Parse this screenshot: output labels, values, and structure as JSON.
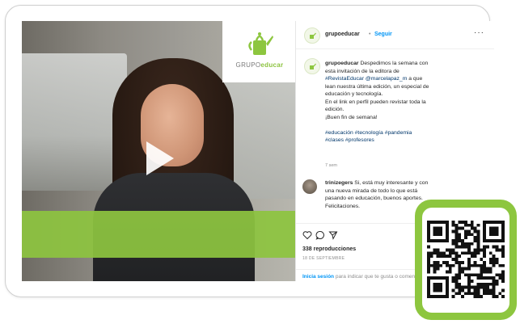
{
  "colors": {
    "brand_green": "#8dc63f",
    "link_blue": "#0095f6",
    "hashtag_blue": "#00376b",
    "muted_gray": "#8e8e8e"
  },
  "video": {
    "logo_text_prefix": "GRUPO",
    "logo_text_brand": "educar",
    "play_icon": "play-icon"
  },
  "header": {
    "username": "grupoeducar",
    "separator": "•",
    "follow_label": "Seguir",
    "more_label": "···"
  },
  "caption": {
    "username": "grupoeducar",
    "line1": "Despedimos la semana con",
    "line2": "esta invitación de la editora de",
    "tag1": "#RevistaEducar",
    "tag2": "@marcelapaz_m",
    "line3_suffix": "a que",
    "line4": "lean nuestra última edición, un especial de",
    "line5": "educación y tecnología.",
    "line6": "En el link en perfil pueden revistar toda la",
    "line7": "edición.",
    "line8": "¡Buen fin de semana!",
    "hashtags1": "#educación #tecnología #pandemia",
    "hashtags2": "#clases #profesores",
    "age": "7 sem"
  },
  "comment": {
    "username": "trinizegers",
    "line1": "Si, está muy interesante y con",
    "line2": "una nueva mirada de todo lo que está",
    "line3": "pasando en educación, buenos aportes.",
    "line4": "Felicitaciones."
  },
  "actions": {
    "like_icon": "heart-icon",
    "comment_icon": "comment-icon",
    "share_icon": "share-icon",
    "views": "338 reproducciones",
    "date": "18 DE SEPTIEMBRE"
  },
  "login": {
    "link": "Inicia sesión",
    "text": "para indicar que te gusta o comentar."
  },
  "qr": {
    "icon": "qr-code-icon"
  }
}
